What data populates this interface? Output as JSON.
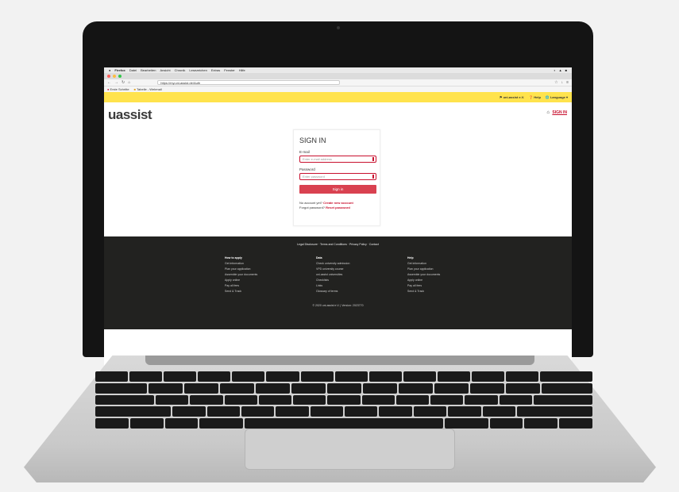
{
  "browser": {
    "menu": [
      "Firefox",
      "Datei",
      "Bearbeiten",
      "Ansicht",
      "Chronik",
      "Lesezeichen",
      "Extras",
      "Fenster",
      "Hilfe"
    ],
    "url": "https://my.uni-assist.de/Auth",
    "bookmarks": [
      "Erste Schritte",
      "Tabelle - Webmail"
    ]
  },
  "site": {
    "topbar": [
      "uni-assist e.V.",
      "Help",
      "Language"
    ],
    "logo": "uassist",
    "signin_link": "SIGN IN"
  },
  "signin": {
    "title": "SIGN IN",
    "email_label": "E-mail",
    "email_placeholder": "Enter e-mail address",
    "password_label": "Password",
    "password_placeholder": "Enter password",
    "button": "Sign in",
    "no_account_text": "No account yet?",
    "no_account_link": "Create new account",
    "forgot_text": "Forgot password?",
    "forgot_link": "Reset password"
  },
  "footer": {
    "links": "Legal Disclosure · Terms and Conditions · Privacy Policy · Contact",
    "columns": [
      {
        "heading": "How to apply",
        "items": [
          "Get information",
          "Plan your application",
          "Assemble your documents",
          "Apply online",
          "Pay all fees",
          "Send & Track"
        ]
      },
      {
        "heading": "Data",
        "items": [
          "Check university admission",
          "VPD university course",
          "uni-assist universities",
          "Checklists",
          "Links",
          "Glossary of terms"
        ]
      },
      {
        "heading": "Help",
        "items": [
          "Get information",
          "Plan your application",
          "Assemble your documents",
          "Apply online",
          "Pay all fees",
          "Send & Track"
        ]
      }
    ],
    "copyright": "© 2020 uni-assist e.V. | Version: 2023770"
  }
}
